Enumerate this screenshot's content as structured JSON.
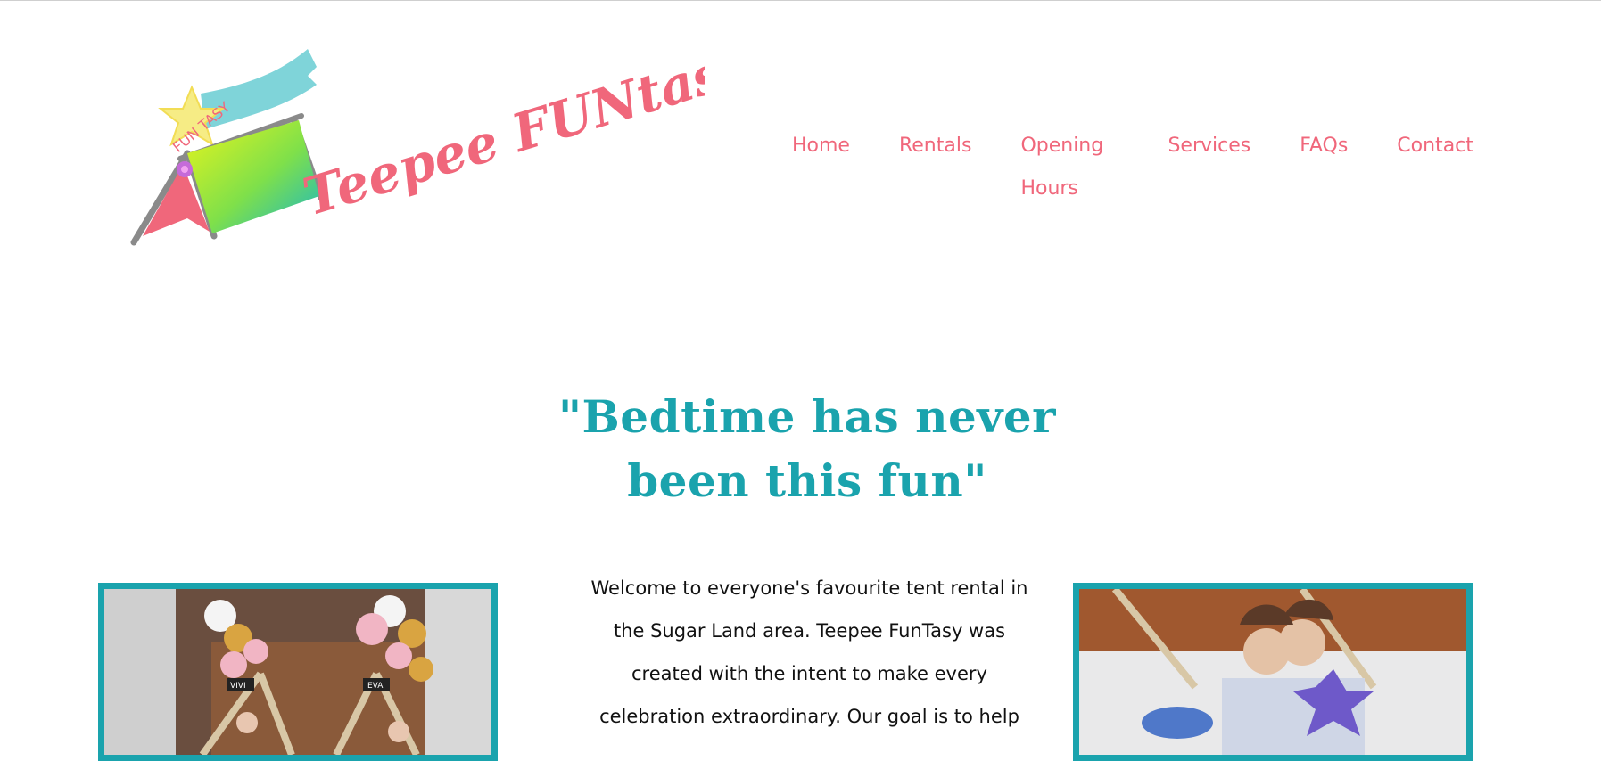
{
  "brand": {
    "name": "Teepee FUNtasy",
    "banner_text": "FUN TASY",
    "colors": {
      "pink": "#f0677b",
      "teal": "#1aa3ad",
      "banner": "#7fd4d9"
    }
  },
  "nav": {
    "items": [
      {
        "label": "Home"
      },
      {
        "label": "Rentals"
      },
      {
        "label": "Opening Hours"
      },
      {
        "label": "Services"
      },
      {
        "label": "FAQs"
      },
      {
        "label": "Contact"
      }
    ]
  },
  "hero": {
    "heading": "\"Bedtime has never been this fun\"",
    "intro": "Welcome to everyone's favourite tent rental in the Sugar Land area. Teepee FunTasy was created with the intent to make every celebration extraordinary. Our goal is to help"
  },
  "photos": {
    "left": {
      "labels": [
        "VIVI",
        "EVA"
      ]
    },
    "right": {}
  }
}
